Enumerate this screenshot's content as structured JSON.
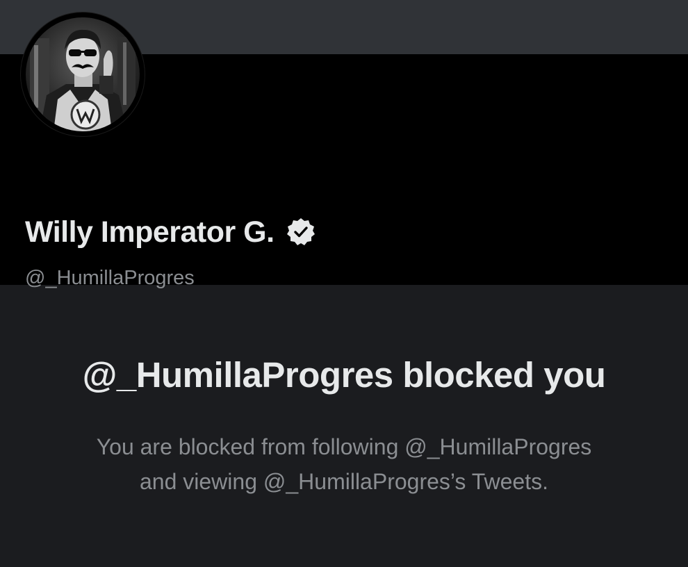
{
  "profile": {
    "display_name": "Willy Imperator G.",
    "handle": "@_HumillaProgres",
    "verified": true,
    "avatar_icon": "profile-photo",
    "verified_icon": "verified-badge-icon"
  },
  "blocked_notice": {
    "title": "@_HumillaProgres blocked you",
    "line1": "You are blocked from following @_HumillaProgres",
    "line2": "and viewing @_HumillaProgres’s Tweets."
  },
  "colors": {
    "banner": "#303337",
    "profile_background": "#000000",
    "page_background": "#1b1c1f",
    "primary_text": "#e7e9ea",
    "secondary_text": "#8b8e92"
  }
}
